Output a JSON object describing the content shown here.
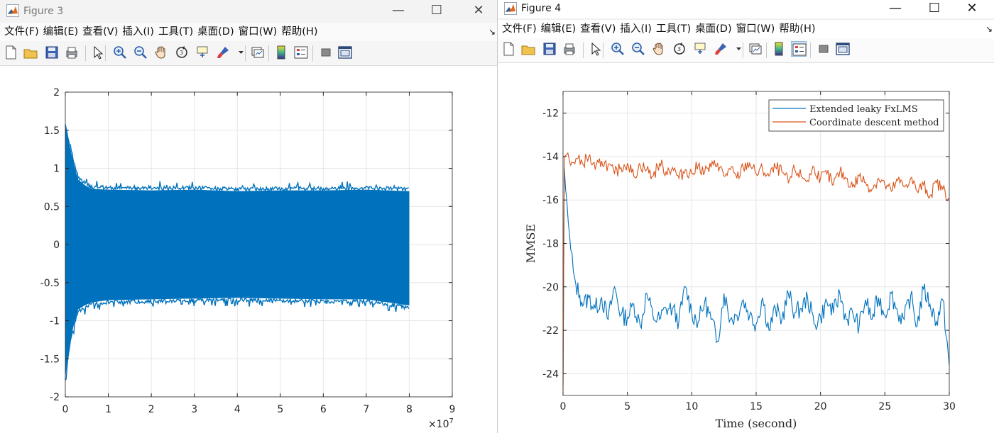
{
  "menu_items": [
    "文件(F)",
    "编辑(E)",
    "查看(V)",
    "插入(I)",
    "工具(T)",
    "桌面(D)",
    "窗口(W)",
    "帮助(H)"
  ],
  "toolbar_icons": [
    "new-file-icon",
    "open-folder-icon",
    "save-icon",
    "print-icon",
    "pointer-icon",
    "zoom-in-icon",
    "zoom-out-icon",
    "pan-hand-icon",
    "rotate-3d-icon",
    "data-cursor-icon",
    "brush-icon",
    "dropdown-arrow-icon",
    "link-plot-icon",
    "colorbar-icon",
    "legend-icon",
    "hide-plot-tools-icon",
    "show-plot-tools-icon"
  ],
  "colors": {
    "blue": "#0072bd",
    "orange": "#d95319"
  },
  "window3": {
    "title": "Figure 3",
    "controls": {
      "minimize": "—",
      "maximize": "☐",
      "close": "✕"
    },
    "chart_data": {
      "type": "line",
      "x_ticks": [
        "0",
        "1",
        "2",
        "3",
        "4",
        "5",
        "6",
        "7",
        "8",
        "9"
      ],
      "x_exponent_base": "×10",
      "x_exponent_power": "7",
      "xlim": [
        0,
        9
      ],
      "y_ticks": [
        "2",
        "1.5",
        "1",
        "0.5",
        "0",
        "-0.5",
        "-1",
        "-1.5",
        "-2"
      ],
      "ylim": [
        -2,
        2
      ],
      "grid": true,
      "series": [
        {
          "color": "#0072bd",
          "x_range": [
            0,
            8
          ],
          "envelope_upper": [
            [
              0,
              1.55
            ],
            [
              0.1,
              1.3
            ],
            [
              0.2,
              1.05
            ],
            [
              0.3,
              0.85
            ],
            [
              0.45,
              0.78
            ],
            [
              0.6,
              0.73
            ],
            [
              1,
              0.72
            ],
            [
              2,
              0.71
            ],
            [
              3,
              0.72
            ],
            [
              4,
              0.7
            ],
            [
              5,
              0.71
            ],
            [
              6,
              0.71
            ],
            [
              7,
              0.72
            ],
            [
              8,
              0.7
            ]
          ],
          "envelope_lower": [
            [
              0,
              -1.75
            ],
            [
              0.1,
              -1.3
            ],
            [
              0.2,
              -1.05
            ],
            [
              0.3,
              -0.85
            ],
            [
              0.45,
              -0.8
            ],
            [
              0.6,
              -0.76
            ],
            [
              1,
              -0.73
            ],
            [
              2,
              -0.72
            ],
            [
              3,
              -0.71
            ],
            [
              4,
              -0.7
            ],
            [
              5,
              -0.71
            ],
            [
              6,
              -0.72
            ],
            [
              7,
              -0.72
            ],
            [
              8,
              -0.8
            ]
          ]
        }
      ]
    }
  },
  "window4": {
    "title": "Figure 4",
    "controls": {
      "minimize": "—",
      "maximize": "☐",
      "close": "✕"
    },
    "chart_data": {
      "type": "line",
      "xlabel": "Time (second)",
      "ylabel": "MMSE",
      "xlim": [
        0,
        30
      ],
      "ylim": [
        -25,
        -11
      ],
      "x_ticks": [
        "0",
        "5",
        "10",
        "15",
        "20",
        "25",
        "30"
      ],
      "y_ticks": [
        "-12",
        "-14",
        "-16",
        "-18",
        "-20",
        "-22",
        "-24"
      ],
      "grid": true,
      "legend_position": "top-right",
      "series": [
        {
          "name": "Extended leaky FxLMS",
          "color": "#0072bd",
          "x": [
            0,
            0.1,
            0.2,
            0.4,
            0.6,
            0.8,
            1.0,
            1.3,
            1.6,
            2.0,
            2.5,
            3.0,
            3.5,
            4.0,
            4.5,
            5.0,
            5.5,
            6.0,
            6.5,
            7.0,
            7.5,
            8.0,
            8.5,
            9.0,
            9.5,
            10.0,
            10.5,
            11.0,
            11.5,
            12.0,
            12.5,
            13.0,
            13.5,
            14.0,
            14.5,
            15.0,
            15.5,
            16.0,
            16.5,
            17.0,
            17.5,
            18.0,
            18.5,
            19.0,
            19.5,
            20.0,
            20.5,
            21.0,
            21.5,
            22.0,
            22.5,
            23.0,
            23.5,
            24.0,
            24.5,
            25.0,
            25.5,
            26.0,
            26.5,
            27.0,
            27.5,
            28.0,
            28.5,
            29.0,
            29.5,
            30.0
          ],
          "y": [
            -24.5,
            -14.5,
            -15.5,
            -17.0,
            -18.3,
            -19.3,
            -19.9,
            -20.4,
            -20.8,
            -20.5,
            -21.0,
            -20.5,
            -21.5,
            -20.0,
            -21.3,
            -21.4,
            -20.8,
            -21.8,
            -20.3,
            -21.4,
            -21.5,
            -21.0,
            -21.0,
            -21.6,
            -20.0,
            -21.2,
            -21.6,
            -20.7,
            -21.5,
            -22.5,
            -20.3,
            -21.5,
            -21.3,
            -20.6,
            -21.3,
            -21.7,
            -20.5,
            -22.0,
            -21.0,
            -21.5,
            -20.3,
            -21.2,
            -21.0,
            -20.5,
            -21.7,
            -21.4,
            -20.7,
            -21.2,
            -20.3,
            -21.5,
            -21.2,
            -21.8,
            -20.6,
            -21.5,
            -20.5,
            -21.3,
            -20.3,
            -21.2,
            -21.5,
            -20.4,
            -21.8,
            -20.1,
            -20.8,
            -21.6,
            -20.6,
            -23.6
          ]
        },
        {
          "name": "Coordinate descent method",
          "color": "#d95319",
          "x": [
            0,
            0.1,
            0.3,
            0.6,
            1.0,
            1.5,
            2.0,
            2.5,
            3.0,
            3.5,
            4.0,
            4.5,
            5.0,
            5.5,
            6.0,
            6.5,
            7.0,
            7.5,
            8.0,
            8.5,
            9.0,
            9.5,
            10.0,
            10.5,
            11.0,
            11.5,
            12.0,
            12.5,
            13.0,
            13.5,
            14.0,
            14.5,
            15.0,
            15.5,
            16.0,
            16.5,
            17.0,
            17.5,
            18.0,
            18.5,
            19.0,
            19.5,
            20.0,
            20.5,
            21.0,
            21.5,
            22.0,
            22.5,
            23.0,
            23.5,
            24.0,
            24.5,
            25.0,
            25.5,
            26.0,
            26.5,
            27.0,
            27.5,
            28.0,
            28.5,
            29.0,
            29.5,
            30.0
          ],
          "y": [
            -24.8,
            -14.0,
            -13.9,
            -14.4,
            -14.1,
            -14.3,
            -14.0,
            -14.6,
            -14.2,
            -14.4,
            -14.8,
            -14.5,
            -14.3,
            -14.9,
            -14.4,
            -14.6,
            -14.9,
            -14.3,
            -14.7,
            -14.5,
            -15.0,
            -14.6,
            -14.8,
            -14.4,
            -14.7,
            -14.5,
            -14.3,
            -14.9,
            -14.6,
            -15.0,
            -14.5,
            -14.3,
            -14.8,
            -14.6,
            -14.9,
            -14.5,
            -14.7,
            -15.2,
            -14.6,
            -14.9,
            -15.1,
            -14.5,
            -15.0,
            -14.8,
            -15.3,
            -14.7,
            -15.0,
            -15.4,
            -14.9,
            -15.2,
            -15.5,
            -15.0,
            -15.3,
            -15.6,
            -15.1,
            -15.4,
            -15.0,
            -15.6,
            -15.3,
            -15.8,
            -15.2,
            -15.5,
            -15.9
          ]
        }
      ]
    }
  }
}
